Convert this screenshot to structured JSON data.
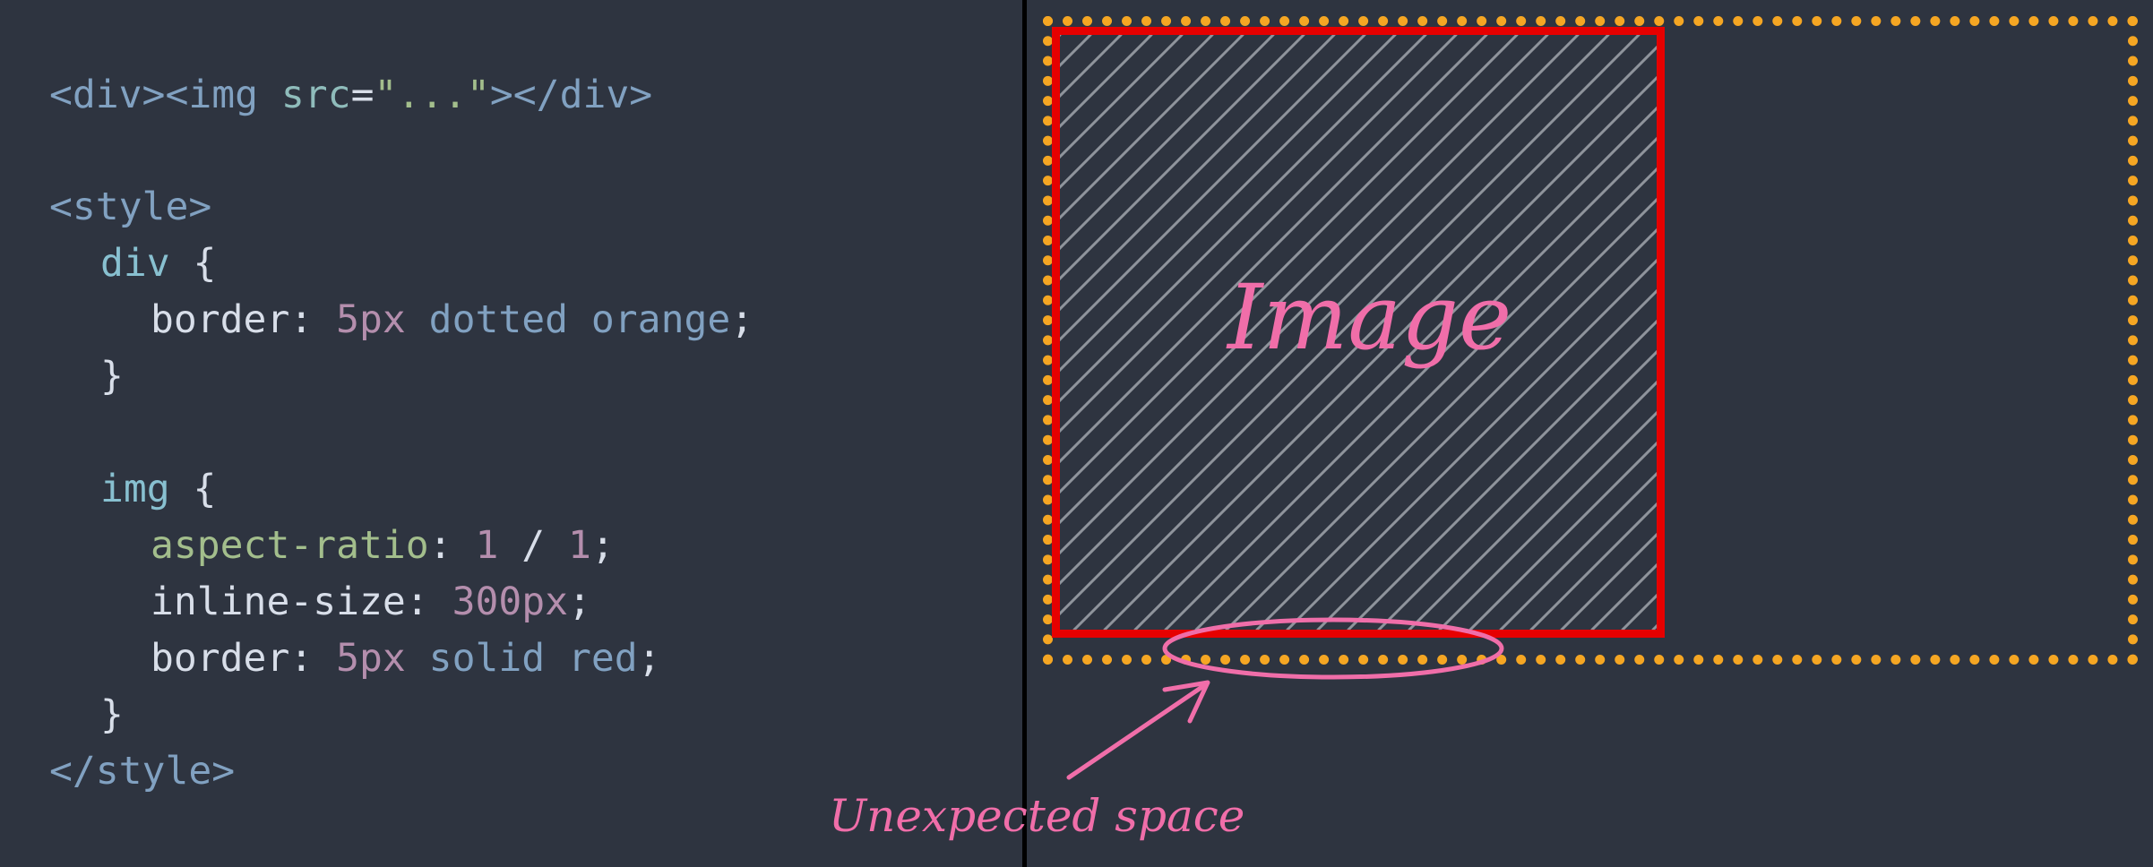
{
  "code": {
    "line1": {
      "open_tag": "<div><img",
      "attr_name": " src",
      "eq": "=",
      "attr_value": "\"...\"",
      "close": "></div>"
    },
    "style_open": "<style>",
    "div_selector": "div",
    "brace_open": " {",
    "div_border_prop": "border",
    "colon": ": ",
    "div_border_num": "5px",
    "div_border_rest": " dotted orange",
    "semicolon": ";",
    "brace_close": "}",
    "img_selector": "img",
    "aspect_prop": "aspect-ratio",
    "aspect_num1": "1",
    "aspect_slash": " / ",
    "aspect_num2": "1",
    "inline_prop": "inline-size",
    "inline_num": "300px",
    "img_border_prop": "border",
    "img_border_num": "5px",
    "img_border_rest": " solid red",
    "style_close": "</style>"
  },
  "preview": {
    "image_label": "Image",
    "annotation": "Unexpected space"
  },
  "colors": {
    "background": "#2e3440",
    "div_border": "#f5a623",
    "img_border": "#e60000",
    "annotation": "#f06ea9"
  }
}
